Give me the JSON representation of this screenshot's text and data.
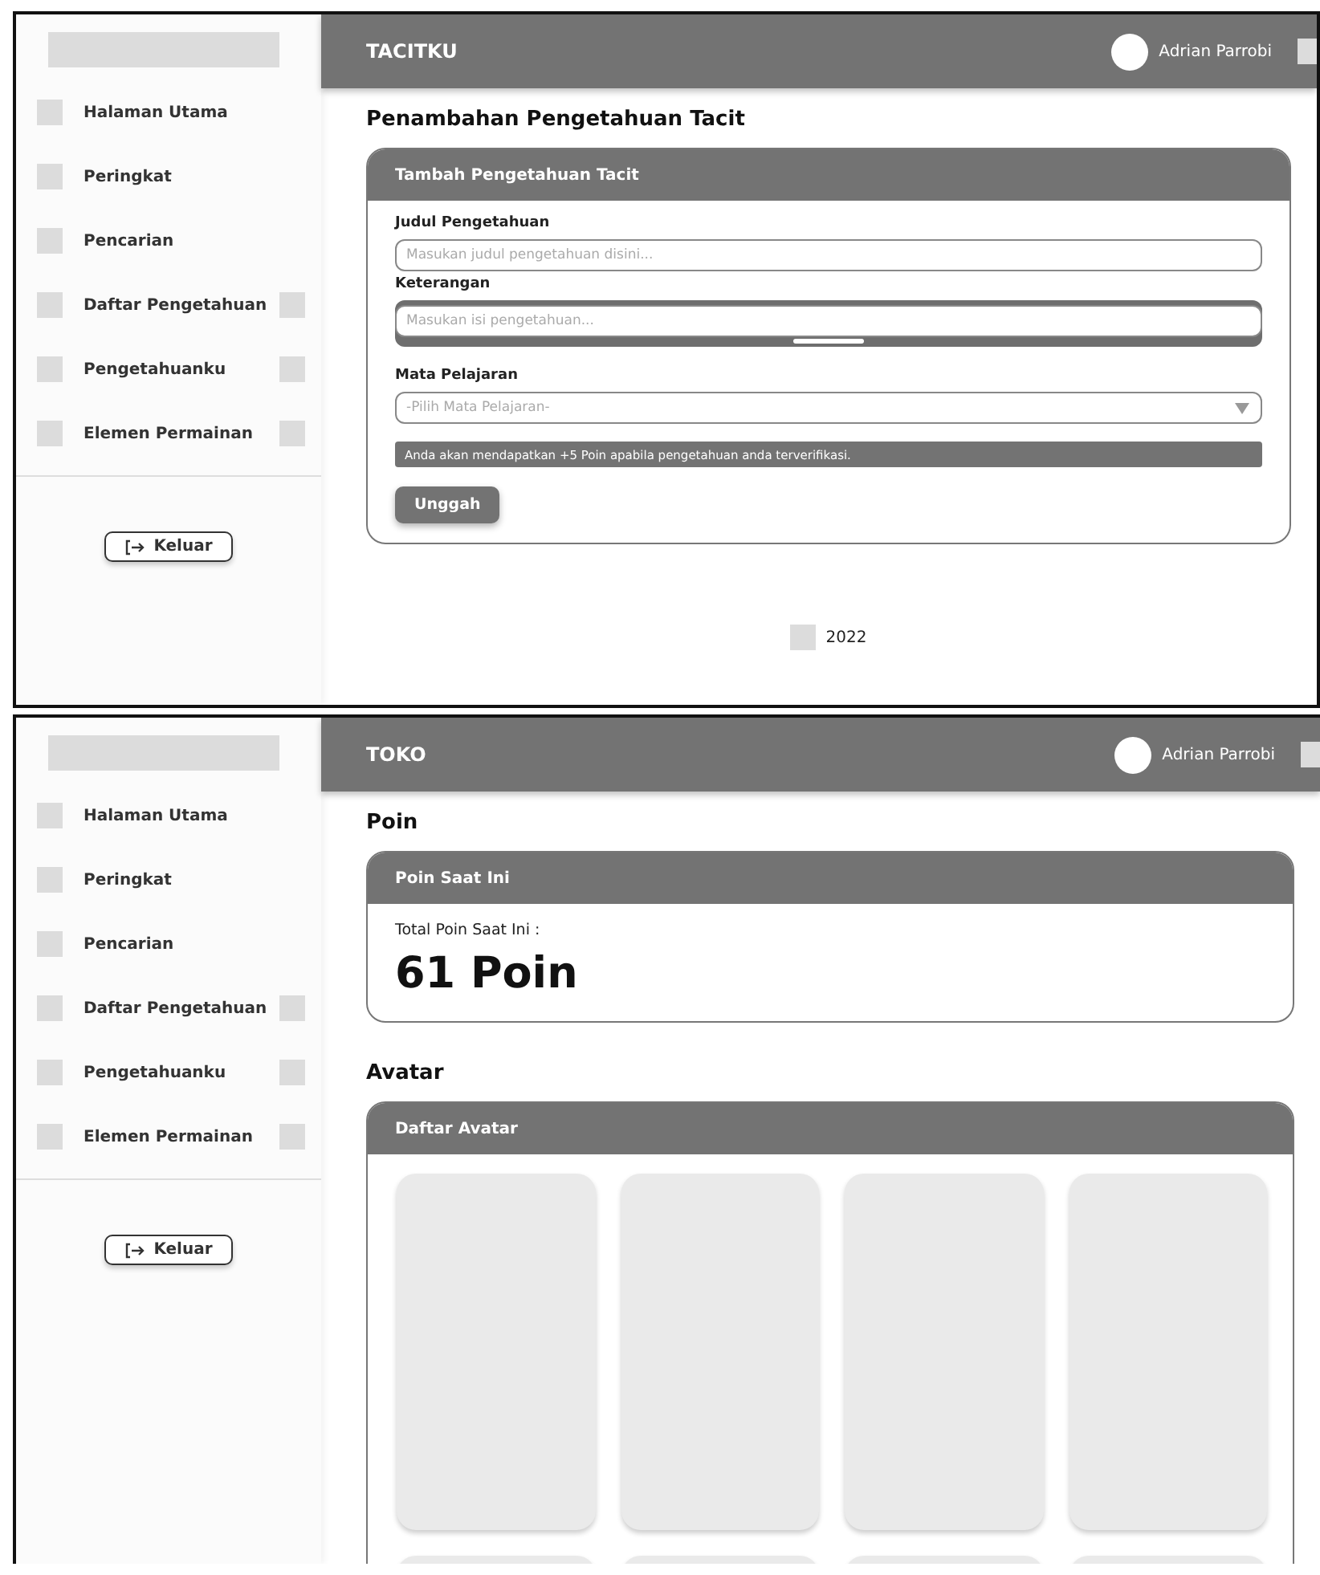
{
  "screens": [
    {
      "header": {
        "title": "TACITKU",
        "user": "Adrian Parrobi"
      },
      "sidebar": {
        "items": [
          {
            "label": "Halaman Utama",
            "badge": false
          },
          {
            "label": "Peringkat",
            "badge": false
          },
          {
            "label": "Pencarian",
            "badge": false
          },
          {
            "label": "Daftar Pengetahuan",
            "badge": true
          },
          {
            "label": "Pengetahuanku",
            "badge": true
          },
          {
            "label": "Elemen Permainan",
            "badge": true
          }
        ],
        "logout": "Keluar"
      },
      "sections": [
        {
          "kind": "form",
          "heading": "Penambahan Pengetahuan Tacit",
          "card_title": "Tambah Pengetahuan Tacit",
          "fields": [
            {
              "kind": "text",
              "label": "Judul Pengetahuan",
              "placeholder": "Masukan judul pengetahuan disini..."
            },
            {
              "kind": "textarea",
              "label": "Keterangan",
              "placeholder": "Masukan isi pengetahuan..."
            },
            {
              "kind": "select",
              "label": "Mata Pelajaran",
              "placeholder": "-Pilih Mata Pelajaran-"
            }
          ],
          "notice": "Anda akan mendapatkan +5 Poin apabila pengetahuan anda terverifikasi.",
          "button": "Unggah"
        }
      ],
      "footer": {
        "year": "2022"
      }
    },
    {
      "header": {
        "title": "TOKO",
        "user": "Adrian Parrobi"
      },
      "sidebar": {
        "items": [
          {
            "label": "Halaman Utama",
            "badge": false
          },
          {
            "label": "Peringkat",
            "badge": false
          },
          {
            "label": "Pencarian",
            "badge": false
          },
          {
            "label": "Daftar Pengetahuan",
            "badge": true
          },
          {
            "label": "Pengetahuanku",
            "badge": true
          },
          {
            "label": "Elemen Permainan",
            "badge": true
          }
        ],
        "logout": "Keluar"
      },
      "sections": [
        {
          "kind": "points",
          "heading": "Poin",
          "card_title": "Poin Saat Ini",
          "label": "Total Poin Saat Ini :",
          "value": "61 Poin"
        },
        {
          "kind": "avatars",
          "heading": "Avatar",
          "card_title": "Daftar Avatar",
          "avatars": [
            {
              "kind": "tile"
            },
            {
              "kind": "tile"
            },
            {
              "kind": "tile"
            },
            {
              "kind": "tile"
            },
            {
              "kind": "tile"
            },
            {
              "kind": "tile"
            },
            {
              "kind": "tile"
            },
            {
              "kind": "tile"
            }
          ]
        }
      ]
    }
  ]
}
